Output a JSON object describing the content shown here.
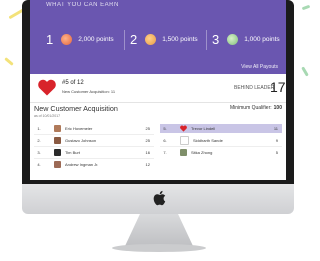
{
  "banner": {
    "title": "WHAT YOU CAN EARN",
    "rewards": [
      {
        "num": "1",
        "points": "2,000 points",
        "color": "#e4643c"
      },
      {
        "num": "2",
        "points": "1,500 points",
        "color": "#e89a45"
      },
      {
        "num": "3",
        "points": "1,000 points",
        "color": "#7fbf7a"
      }
    ],
    "view_all": "View All Payouts"
  },
  "rank": {
    "main": "#5 of 12",
    "sub": "New Customer Acquisition: 11",
    "behind_label": "BEHIND LEADER",
    "behind_value": "17"
  },
  "section": {
    "title": "New Customer Acquisition",
    "date": "as of 10/01/2017",
    "min_qual_label": "Minimum Qualifier:",
    "min_qual_value": "100"
  },
  "leaderboard": {
    "left": [
      {
        "rank": "1.",
        "name": "Eric Hovemeier",
        "score": "25",
        "avatar_color": "#b07a5a"
      },
      {
        "rank": "2.",
        "name": "Gustavo Johnson",
        "score": "25",
        "avatar_color": "#8a5a42"
      },
      {
        "rank": "3.",
        "name": "Tim Burt",
        "score": "16",
        "avatar_color": "#2a2a2a"
      },
      {
        "rank": "4.",
        "name": "Andrew Ingman Jr.",
        "score": "12",
        "avatar_color": "#9c6a55"
      }
    ],
    "right": [
      {
        "rank": "5.",
        "name": "Trevor Lindell",
        "score": "11",
        "avatar_color": "#d8232a",
        "highlight": true
      },
      {
        "rank": "6.",
        "name": "Siddharth Sande",
        "score": "9",
        "avatar_color": "#ffffff"
      },
      {
        "rank": "7.",
        "name": "Sitka Zhong",
        "score": "5",
        "avatar_color": "#7f8f6a"
      }
    ]
  },
  "colors": {
    "banner": "#6a56b0",
    "heart": "#d8232a",
    "highlight_row": "#c9c5e6"
  }
}
